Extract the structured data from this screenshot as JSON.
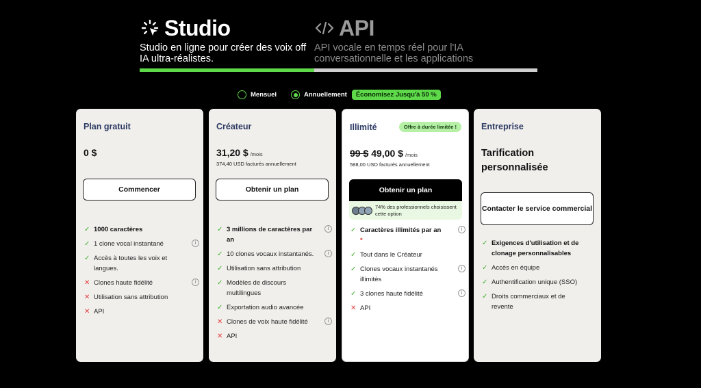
{
  "tabs": {
    "studio": {
      "icon": "loader-cursor-icon",
      "title": "Studio",
      "subtitle": "Studio en ligne pour créer des voix off IA ultra-réalistes."
    },
    "api": {
      "icon": "code-icon",
      "title": "API",
      "subtitle": "API vocale en temps réel pour l'IA conversationnelle et les applications"
    }
  },
  "billing": {
    "monthly": "Mensuel",
    "yearly": "Annuellement",
    "selected": "Annuellement",
    "savings_badge": "Économisez Jusqu'à 50 %"
  },
  "plans": [
    {
      "name": "Plan gratuit",
      "price": "0 $",
      "cta": "Commencer",
      "features": [
        {
          "text": "1000 caractères",
          "included": true,
          "bold": true,
          "info": false
        },
        {
          "text": "1 clone vocal instantané",
          "included": true,
          "bold": false,
          "info": true
        },
        {
          "text": "Accès à toutes les voix et langues.",
          "included": true,
          "bold": false,
          "info": false
        },
        {
          "text": "Clones haute fidélité",
          "included": false,
          "bold": false,
          "info": true
        },
        {
          "text": "Utilisation sans attribution",
          "included": false,
          "bold": false,
          "info": false
        },
        {
          "text": "API",
          "included": false,
          "bold": false,
          "info": false
        }
      ]
    },
    {
      "name": "Créateur",
      "price": "31,20 $",
      "per": "/mois",
      "billed": "374,40 USD facturés annuellement",
      "cta": "Obtenir un plan",
      "features": [
        {
          "text": "3 millions de caractères par an",
          "included": true,
          "bold": true,
          "info": true
        },
        {
          "text": "10 clones vocaux instantanés.",
          "included": true,
          "bold": false,
          "info": true
        },
        {
          "text": "Utilisation sans attribution",
          "included": true,
          "bold": false,
          "info": false
        },
        {
          "text": "Modèles de discours multilingues",
          "included": true,
          "bold": false,
          "info": false
        },
        {
          "text": "Exportation audio avancée",
          "included": true,
          "bold": false,
          "info": false
        },
        {
          "text": "Clones de voix haute fidélité",
          "included": false,
          "bold": false,
          "info": true
        },
        {
          "text": "API",
          "included": false,
          "bold": false,
          "info": false
        }
      ]
    },
    {
      "name": "Illimité",
      "promo": "Offre à durée limitée !",
      "price_old": "99 $",
      "price": "49,00 $",
      "per": "/mois",
      "billed": "588,00 USD facturés annuellement",
      "cta": "Obtenir un plan",
      "social_proof": "74% des professionnels choisissent cette option",
      "features": [
        {
          "text": "Caractères illimités par an",
          "included": true,
          "bold": true,
          "info": true,
          "star": "*"
        },
        {
          "text": "Tout dans le Créateur",
          "included": true,
          "bold": false,
          "info": false
        },
        {
          "text": "Clones vocaux instantanés illimités",
          "included": true,
          "bold": false,
          "info": true
        },
        {
          "text": "3 clones haute fidélité",
          "included": true,
          "bold": false,
          "info": true
        },
        {
          "text": "API",
          "included": false,
          "bold": false,
          "info": false
        }
      ]
    },
    {
      "name": "Entreprise",
      "price": "Tarification personnalisée",
      "cta": "Contacter le service commercial",
      "features": [
        {
          "text": "Exigences d'utilisation et de clonage personnalisables",
          "included": true,
          "bold": true,
          "info": false
        },
        {
          "text": "Accès en équipe",
          "included": true,
          "bold": false,
          "info": false
        },
        {
          "text": "Authentification unique (SSO)",
          "included": true,
          "bold": false,
          "info": false
        },
        {
          "text": "Droits commerciaux et de revente",
          "included": true,
          "bold": false,
          "info": false
        }
      ]
    }
  ]
}
